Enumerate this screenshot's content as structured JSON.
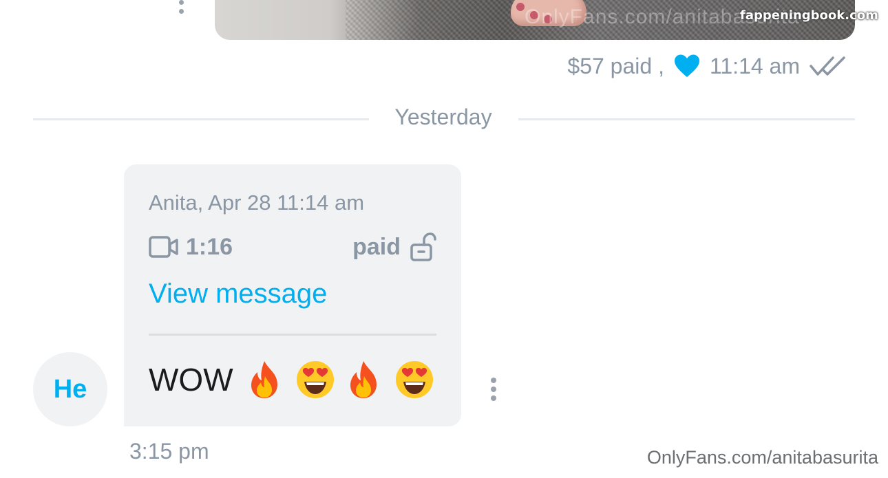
{
  "sent_message": {
    "image_watermark": "OnlyFans.com/anitabasurita",
    "site_badge": "fappeningbook.com",
    "price_text": "$57 paid ,",
    "time": "11:14 am",
    "liked": true,
    "status_icon": "double-check-icon"
  },
  "date_divider": {
    "label": "Yesterday"
  },
  "received_message": {
    "avatar_initials": "He",
    "header": "Anita, Apr 28 11:14 am",
    "media_type_icon": "video-camera-icon",
    "duration": "1:16",
    "paid_label": "paid",
    "lock_icon": "unlocked-lock-icon",
    "view_link": "View message",
    "text": "WOW",
    "emojis": [
      "fire",
      "heart-eyes",
      "fire",
      "heart-eyes"
    ],
    "time": "3:15 pm"
  },
  "footer_watermark": "OnlyFans.com/anitabasurita",
  "colors": {
    "accent": "#00aff0",
    "muted_text": "#8a96a3",
    "bubble_bg": "#f0f2f3",
    "divider": "#e6eaed"
  }
}
